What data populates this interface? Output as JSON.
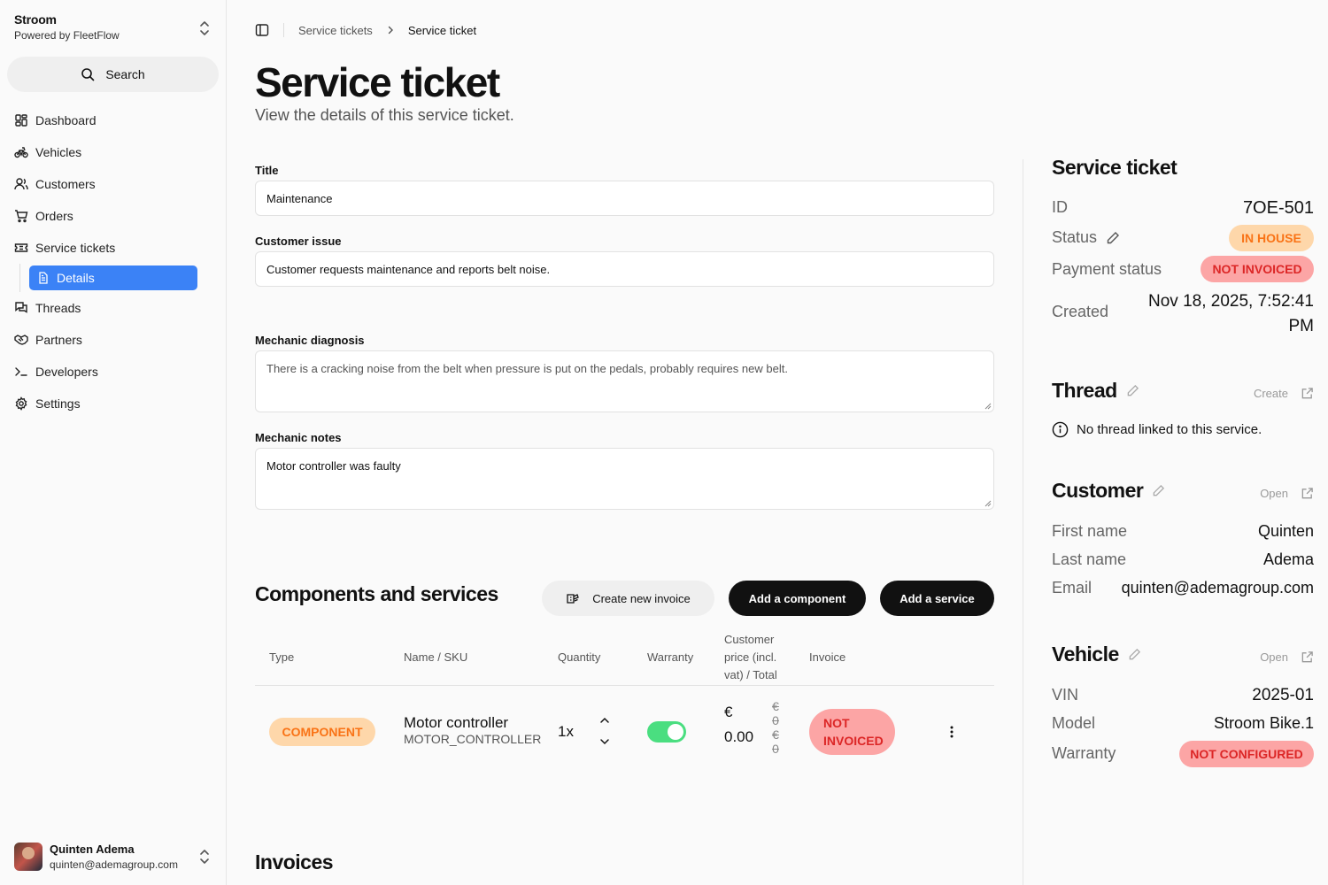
{
  "brand": {
    "name": "Stroom",
    "sub": "Powered by FleetFlow"
  },
  "search": {
    "label": "Search"
  },
  "nav": {
    "dashboard": "Dashboard",
    "vehicles": "Vehicles",
    "customers": "Customers",
    "orders": "Orders",
    "service_tickets": "Service tickets",
    "details": "Details",
    "threads": "Threads",
    "partners": "Partners",
    "developers": "Developers",
    "settings": "Settings"
  },
  "user": {
    "name": "Quinten Adema",
    "email": "quinten@ademagroup.com"
  },
  "breadcrumb": {
    "parent": "Service tickets",
    "current": "Service ticket"
  },
  "page": {
    "title": "Service ticket",
    "subtitle": "View the details of this service ticket."
  },
  "form": {
    "title_label": "Title",
    "title_value": "Maintenance",
    "issue_label": "Customer issue",
    "issue_value": "Customer requests maintenance and reports belt noise.",
    "diagnosis_label": "Mechanic diagnosis",
    "diagnosis_value": "There is a cracking noise from the belt when pressure is put on the pedals, probably requires new belt.",
    "notes_label": "Mechanic notes",
    "notes_value": "Motor controller was faulty"
  },
  "components": {
    "title": "Components and services",
    "create_invoice": "Create new invoice",
    "add_component": "Add a component",
    "add_service": "Add a service",
    "headers": {
      "type": "Type",
      "name": "Name / SKU",
      "quantity": "Quantity",
      "warranty": "Warranty",
      "price_1": "Customer",
      "price_2": "price (incl.",
      "price_3": "vat) / Total",
      "invoice": "Invoice"
    },
    "row": {
      "type": "COMPONENT",
      "name": "Motor controller",
      "sku": "MOTOR_CONTROLLER",
      "quantity": "1x",
      "warranty_on": true,
      "currency": "€",
      "price": "0.00",
      "old_currency_1": "€",
      "old_value_1": "0",
      "old_currency_2": "€",
      "old_value_2": "0",
      "invoice_1": "NOT",
      "invoice_2": "INVOICED"
    }
  },
  "invoices": {
    "title": "Invoices"
  },
  "ticket": {
    "title": "Service ticket",
    "id_label": "ID",
    "id_value": "7OE-501",
    "status_label": "Status",
    "status_value": "IN HOUSE",
    "payment_label": "Payment status",
    "payment_value": "NOT INVOICED",
    "created_label": "Created",
    "created_line1": "Nov 18, 2025, 7:52:41",
    "created_line2": "PM"
  },
  "thread": {
    "title": "Thread",
    "action": "Create",
    "empty": "No thread linked to this service."
  },
  "customer": {
    "title": "Customer",
    "action": "Open",
    "first_label": "First name",
    "first_value": "Quinten",
    "last_label": "Last name",
    "last_value": "Adema",
    "email_label": "Email",
    "email_value": "quinten@ademagroup.com"
  },
  "vehicle": {
    "title": "Vehicle",
    "action": "Open",
    "vin_label": "VIN",
    "vin_value": "2025-01",
    "model_label": "Model",
    "model_value": "Stroom Bike.1",
    "warranty_label": "Warranty",
    "warranty_value": "NOT CONFIGURED"
  },
  "colors": {
    "accent": "#3b82f6",
    "orange_bg": "#fed7aa",
    "orange_text": "#f97316",
    "red_bg": "#fca5a5",
    "red_text": "#dc2626",
    "toggle_on": "#4ade80"
  }
}
